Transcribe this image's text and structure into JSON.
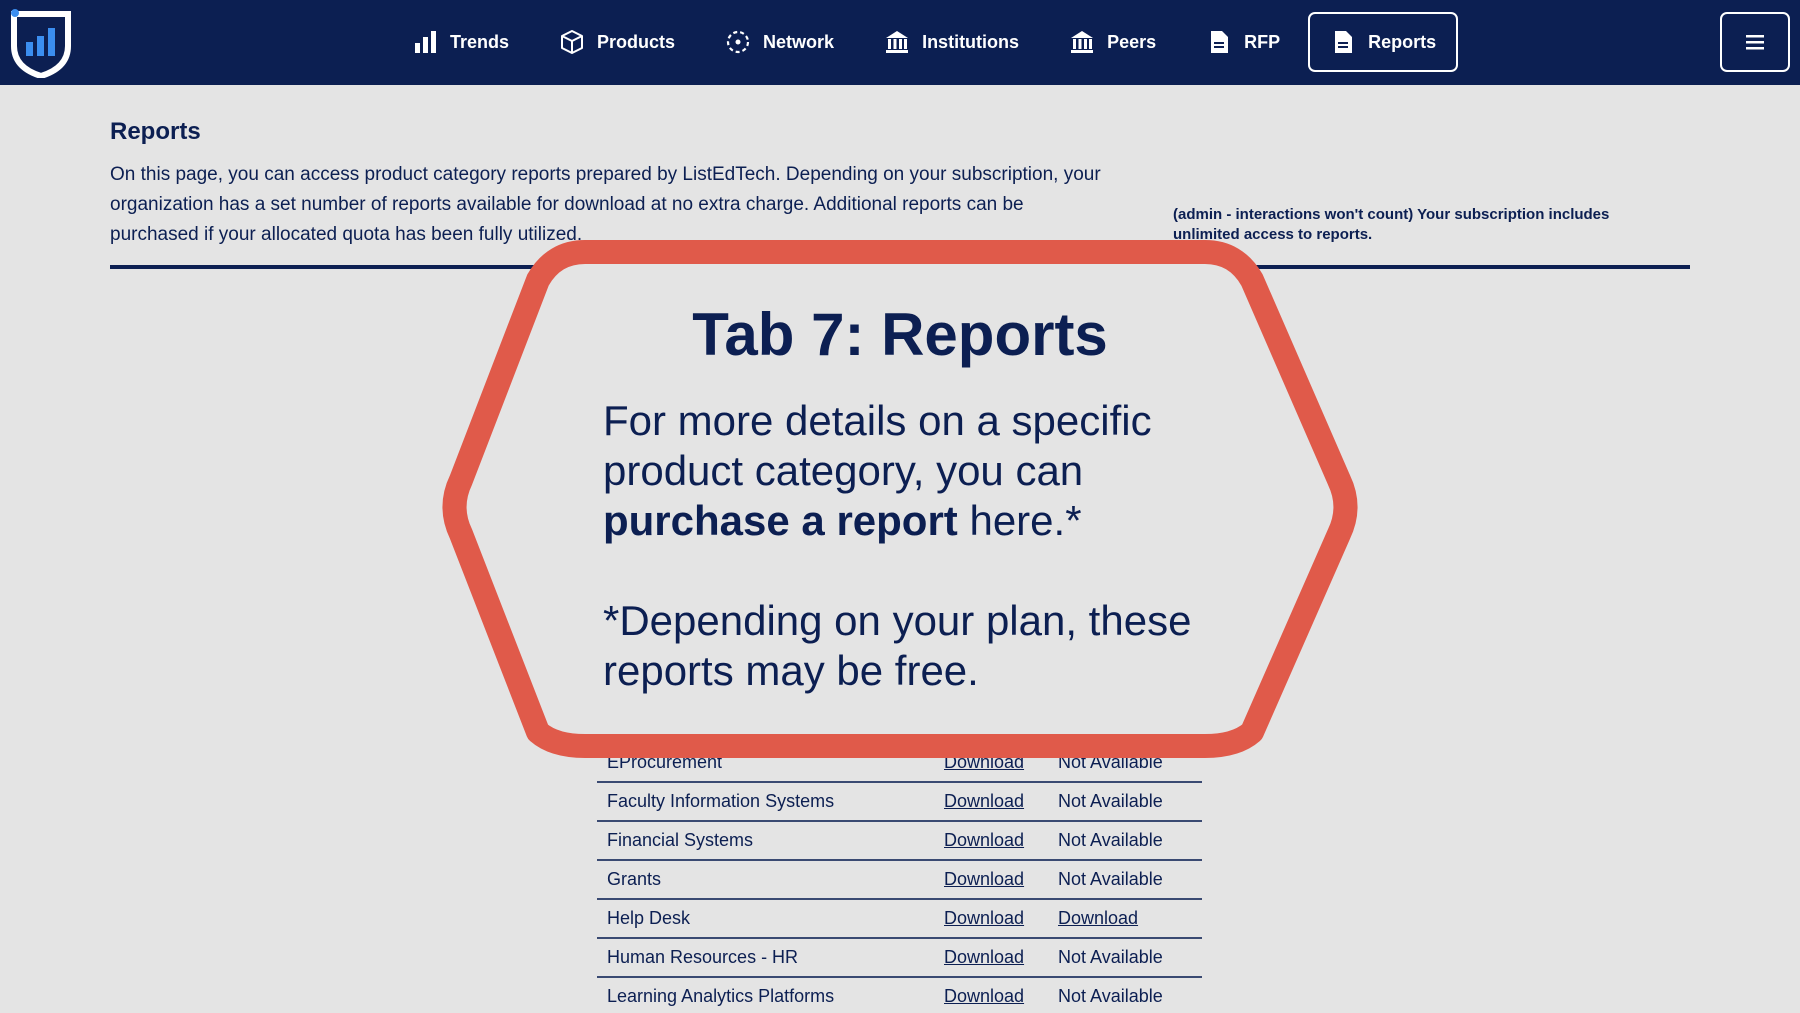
{
  "nav": {
    "items": [
      {
        "label": "Trends",
        "icon": "bar-chart-icon"
      },
      {
        "label": "Products",
        "icon": "cube-icon"
      },
      {
        "label": "Network",
        "icon": "network-icon"
      },
      {
        "label": "Institutions",
        "icon": "institution-icon"
      },
      {
        "label": "Peers",
        "icon": "peers-icon"
      },
      {
        "label": "RFP",
        "icon": "document-icon"
      },
      {
        "label": "Reports",
        "icon": "report-icon",
        "active": true
      }
    ],
    "menu_icon": "hamburger-icon"
  },
  "page": {
    "title": "Reports",
    "intro": "On this page, you can access product category reports prepared by ListEdTech. Depending on your subscription, your organization has a set number of reports available for download at no extra charge. Additional reports can be purchased if your allocated quota has been fully utilized.",
    "admin_note": "(admin - interactions won't count) Your subscription includes unlimited access to reports."
  },
  "callout": {
    "title": "Tab 7: Reports",
    "body_pre": "For more details on a specific product category, you can ",
    "body_bold": "purchase a report",
    "body_post": " here.*",
    "note": "*Depending on your plan, these reports may be free.",
    "border_color": "#e05a4a"
  },
  "reports": {
    "rows": [
      {
        "name": "EProcurement",
        "col1": "Download",
        "col2": "Not Available"
      },
      {
        "name": "Faculty Information Systems",
        "col1": "Download",
        "col2": "Not Available"
      },
      {
        "name": "Financial Systems",
        "col1": "Download",
        "col2": "Not Available"
      },
      {
        "name": "Grants",
        "col1": "Download",
        "col2": "Not Available"
      },
      {
        "name": "Help Desk",
        "col1": "Download",
        "col2": "Download"
      },
      {
        "name": "Human Resources - HR",
        "col1": "Download",
        "col2": "Not Available"
      },
      {
        "name": "Learning Analytics Platforms",
        "col1": "Download",
        "col2": "Not Available"
      }
    ]
  },
  "colors": {
    "navy": "#0c1f52",
    "background": "#e4e4e4",
    "callout_border": "#e05a4a"
  }
}
